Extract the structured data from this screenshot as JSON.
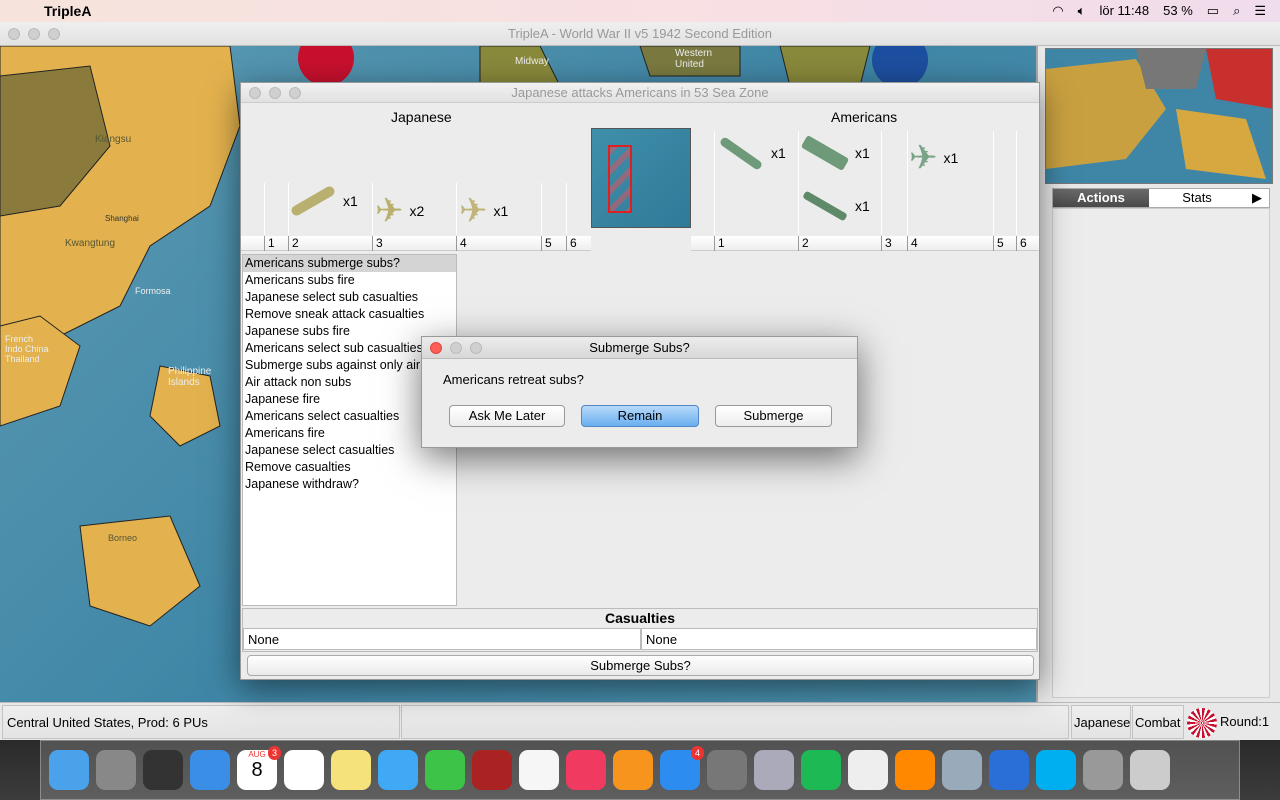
{
  "menubar": {
    "app_name": "TripleA",
    "clock": "lör 11:48",
    "battery": "53 %"
  },
  "window": {
    "title": "TripleA - World War II v5 1942 Second Edition"
  },
  "map": {
    "labels": [
      "Kiangsu",
      "Shanghai",
      "Kwangtung",
      "Formosa",
      "French Indo China Thailand",
      "Philippine Islands",
      "Borneo",
      "Midway",
      "Western United"
    ]
  },
  "right_panel": {
    "tabs": [
      "Actions",
      "Stats"
    ],
    "more_arrow": "▶"
  },
  "battle": {
    "title": "Japanese attacks Americans in 53 Sea Zone",
    "attacker": "Japanese",
    "defender": "Americans",
    "columns": [
      "1",
      "2",
      "3",
      "4",
      "5",
      "6"
    ],
    "attacker_units": [
      {
        "type": "submarine",
        "col": "2",
        "count": "x1"
      },
      {
        "type": "fighter",
        "col": "3",
        "count": "x2"
      },
      {
        "type": "bomber",
        "col": "4",
        "count": "x1"
      }
    ],
    "defender_units": [
      {
        "type": "submarine",
        "col": "1",
        "count": "x1"
      },
      {
        "type": "carrier",
        "col": "2",
        "count": "x1"
      },
      {
        "type": "destroyer",
        "col": "2",
        "count": "x1"
      },
      {
        "type": "fighter",
        "col": "4",
        "count": "x1"
      }
    ],
    "steps": [
      "Americans submerge subs?",
      "Americans subs fire",
      "Japanese select sub casualties",
      "Remove sneak attack casualties",
      "Japanese subs fire",
      "Americans select sub casualties",
      "Submerge subs against only air",
      "Air attack non subs",
      "Japanese fire",
      "Americans select casualties",
      "Americans fire",
      "Japanese select casualties",
      "Remove casualties",
      "Japanese withdraw?"
    ],
    "casualties_title": "Casualties",
    "attacker_casualties": "None",
    "defender_casualties": "None",
    "action_button": "Submerge Subs?"
  },
  "dialog": {
    "title": "Submerge Subs?",
    "message": "Americans retreat subs?",
    "buttons": [
      "Ask Me Later",
      "Remain",
      "Submerge"
    ]
  },
  "status": {
    "territory": "Central United States, Prod: 6 PUs",
    "player": "Japanese",
    "phase": "Combat",
    "round": "Round:1"
  },
  "dock": {
    "apps": [
      "Finder",
      "Launchpad",
      "Mission Control",
      "Safari",
      "Calendar",
      "Reminders",
      "Notes",
      "Messages",
      "FaceTime",
      "Photo Booth",
      "Photos",
      "iTunes",
      "iBooks",
      "App Store",
      "System Preferences",
      "Remote Desktop",
      "Spotify",
      "Chrome",
      "VLC",
      "Preview",
      "OpenOffice",
      "Skype",
      "TripleA",
      "Trash"
    ],
    "calendar_day": "8",
    "calendar_month": "AUG",
    "calendar_badge": "3",
    "appstore_badge": "4"
  },
  "colors": {
    "sea": "#3f86a6",
    "land": "#e0b050",
    "japan": "#c8102e",
    "selection": "#e02020"
  }
}
